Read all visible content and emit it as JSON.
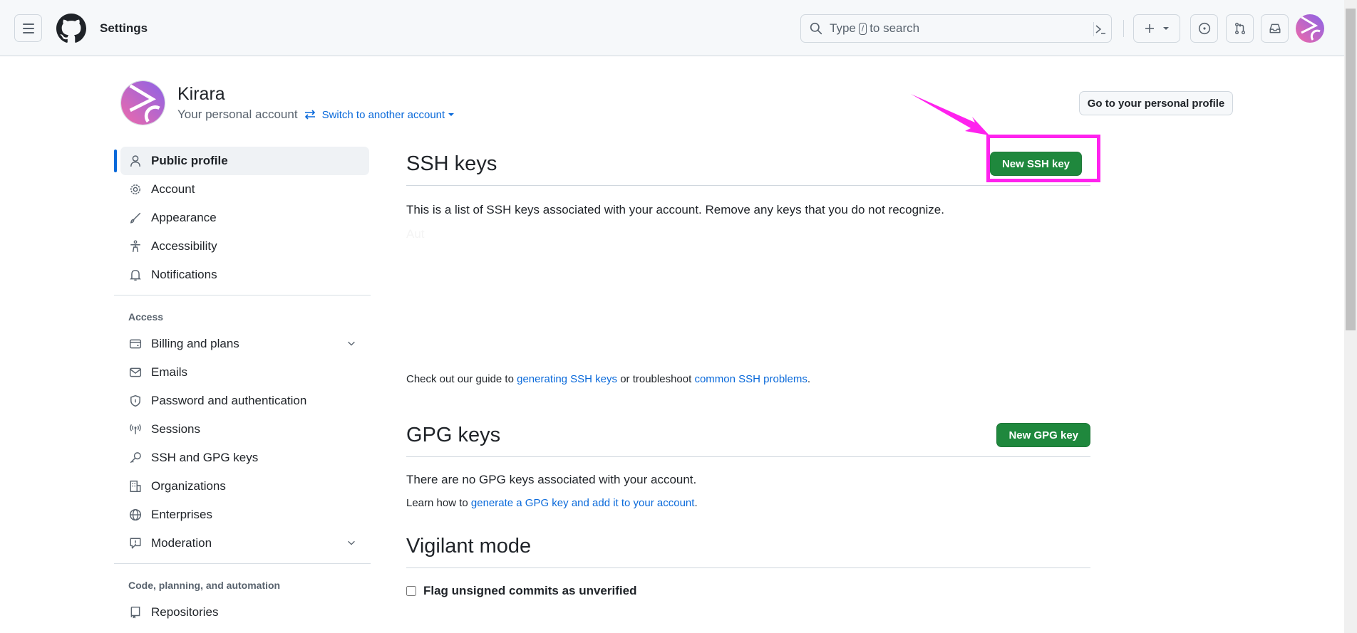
{
  "header": {
    "title": "Settings",
    "search": {
      "placeholder_pre": "Type",
      "placeholder_key": "/",
      "placeholder_post": "to search"
    }
  },
  "profile": {
    "name": "Kirara",
    "subtitle": "Your personal account",
    "switch_label": "Switch to another account",
    "go_profile_label": "Go to your personal profile"
  },
  "sidebar": {
    "items_top": [
      {
        "label": "Public profile",
        "icon": "person-icon",
        "active": true
      },
      {
        "label": "Account",
        "icon": "gear-icon"
      },
      {
        "label": "Appearance",
        "icon": "paintbrush-icon"
      },
      {
        "label": "Accessibility",
        "icon": "accessibility-icon"
      },
      {
        "label": "Notifications",
        "icon": "bell-icon"
      }
    ],
    "group_access": "Access",
    "items_access": [
      {
        "label": "Billing and plans",
        "icon": "credit-card-icon",
        "expandable": true
      },
      {
        "label": "Emails",
        "icon": "mail-icon"
      },
      {
        "label": "Password and authentication",
        "icon": "shield-lock-icon"
      },
      {
        "label": "Sessions",
        "icon": "broadcast-icon"
      },
      {
        "label": "SSH and GPG keys",
        "icon": "key-icon"
      },
      {
        "label": "Organizations",
        "icon": "organization-icon"
      },
      {
        "label": "Enterprises",
        "icon": "globe-icon"
      },
      {
        "label": "Moderation",
        "icon": "report-icon",
        "expandable": true
      }
    ],
    "group_code": "Code, planning, and automation",
    "items_code": [
      {
        "label": "Repositories",
        "icon": "repo-icon"
      }
    ]
  },
  "ssh": {
    "title": "SSH keys",
    "new_button": "New SSH key",
    "description": "This is a list of SSH keys associated with your account. Remove any keys that you do not recognize.",
    "faint_text": "Aut",
    "guide_pre": "Check out our guide to",
    "guide_link1": "generating SSH keys",
    "guide_mid": "or troubleshoot",
    "guide_link2": "common SSH problems",
    "guide_post": "."
  },
  "gpg": {
    "title": "GPG keys",
    "new_button": "New GPG key",
    "empty_text": "There are no GPG keys associated with your account.",
    "learn_pre": "Learn how to",
    "learn_link": "generate a GPG key and add it to your account",
    "learn_post": "."
  },
  "vigilant": {
    "title": "Vigilant mode",
    "checkbox_label": "Flag unsigned commits as unverified",
    "checked": false
  },
  "annotation": {
    "color": "#ff22ee"
  }
}
